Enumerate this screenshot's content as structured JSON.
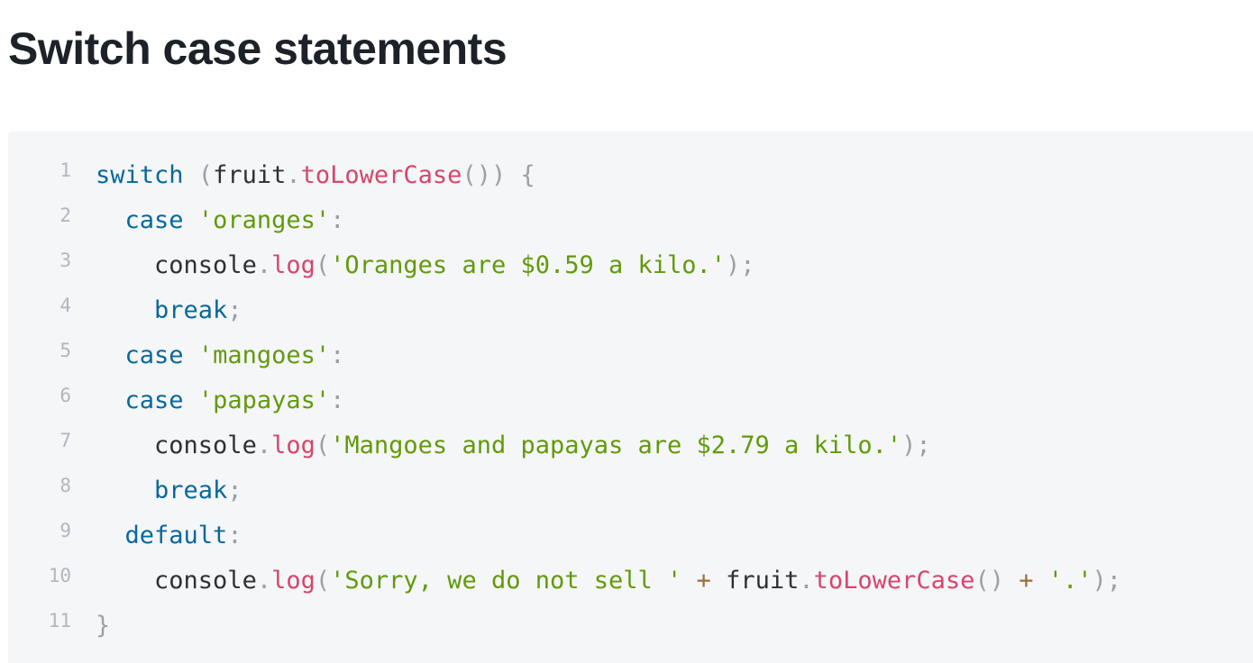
{
  "title": "Switch case statements",
  "colors": {
    "background": "#ffffff",
    "code_background": "#f5f6f8",
    "title": "#1d2228",
    "line_number": "#b1b7be",
    "keyword": "#07689c",
    "plain": "#2d3136",
    "punctuation": "#9aa0a6",
    "function": "#d6466b",
    "string": "#629a0a",
    "operator": "#9a6e3a"
  },
  "code": {
    "language": "javascript",
    "lines": [
      {
        "number": "1",
        "indent": "",
        "tokens": [
          {
            "type": "keyword",
            "text": "switch"
          },
          {
            "type": "plain",
            "text": " "
          },
          {
            "type": "punct",
            "text": "("
          },
          {
            "type": "plain",
            "text": "fruit"
          },
          {
            "type": "punct",
            "text": "."
          },
          {
            "type": "func",
            "text": "toLowerCase"
          },
          {
            "type": "punct",
            "text": "())"
          },
          {
            "type": "plain",
            "text": " "
          },
          {
            "type": "punct",
            "text": "{"
          }
        ]
      },
      {
        "number": "2",
        "indent": "  ",
        "tokens": [
          {
            "type": "keyword",
            "text": "case"
          },
          {
            "type": "plain",
            "text": " "
          },
          {
            "type": "string",
            "text": "'oranges'"
          },
          {
            "type": "punct",
            "text": ":"
          }
        ]
      },
      {
        "number": "3",
        "indent": "    ",
        "tokens": [
          {
            "type": "plain",
            "text": "console"
          },
          {
            "type": "punct",
            "text": "."
          },
          {
            "type": "func",
            "text": "log"
          },
          {
            "type": "punct",
            "text": "("
          },
          {
            "type": "string",
            "text": "'Oranges are $0.59 a kilo.'"
          },
          {
            "type": "punct",
            "text": ");"
          }
        ]
      },
      {
        "number": "4",
        "indent": "    ",
        "tokens": [
          {
            "type": "keyword",
            "text": "break"
          },
          {
            "type": "punct",
            "text": ";"
          }
        ]
      },
      {
        "number": "5",
        "indent": "  ",
        "tokens": [
          {
            "type": "keyword",
            "text": "case"
          },
          {
            "type": "plain",
            "text": " "
          },
          {
            "type": "string",
            "text": "'mangoes'"
          },
          {
            "type": "punct",
            "text": ":"
          }
        ]
      },
      {
        "number": "6",
        "indent": "  ",
        "tokens": [
          {
            "type": "keyword",
            "text": "case"
          },
          {
            "type": "plain",
            "text": " "
          },
          {
            "type": "string",
            "text": "'papayas'"
          },
          {
            "type": "punct",
            "text": ":"
          }
        ]
      },
      {
        "number": "7",
        "indent": "    ",
        "tokens": [
          {
            "type": "plain",
            "text": "console"
          },
          {
            "type": "punct",
            "text": "."
          },
          {
            "type": "func",
            "text": "log"
          },
          {
            "type": "punct",
            "text": "("
          },
          {
            "type": "string",
            "text": "'Mangoes and papayas are $2.79 a kilo.'"
          },
          {
            "type": "punct",
            "text": ");"
          }
        ]
      },
      {
        "number": "8",
        "indent": "    ",
        "tokens": [
          {
            "type": "keyword",
            "text": "break"
          },
          {
            "type": "punct",
            "text": ";"
          }
        ]
      },
      {
        "number": "9",
        "indent": "  ",
        "tokens": [
          {
            "type": "keyword",
            "text": "default"
          },
          {
            "type": "punct",
            "text": ":"
          }
        ]
      },
      {
        "number": "10",
        "indent": "    ",
        "tokens": [
          {
            "type": "plain",
            "text": "console"
          },
          {
            "type": "punct",
            "text": "."
          },
          {
            "type": "func",
            "text": "log"
          },
          {
            "type": "punct",
            "text": "("
          },
          {
            "type": "string",
            "text": "'Sorry, we do not sell '"
          },
          {
            "type": "plain",
            "text": " "
          },
          {
            "type": "op",
            "text": "+"
          },
          {
            "type": "plain",
            "text": " fruit"
          },
          {
            "type": "punct",
            "text": "."
          },
          {
            "type": "func",
            "text": "toLowerCase"
          },
          {
            "type": "punct",
            "text": "()"
          },
          {
            "type": "plain",
            "text": " "
          },
          {
            "type": "op",
            "text": "+"
          },
          {
            "type": "plain",
            "text": " "
          },
          {
            "type": "string",
            "text": "'.'"
          },
          {
            "type": "punct",
            "text": ");"
          }
        ]
      },
      {
        "number": "11",
        "indent": "",
        "tokens": [
          {
            "type": "punct",
            "text": "}"
          }
        ]
      }
    ]
  }
}
